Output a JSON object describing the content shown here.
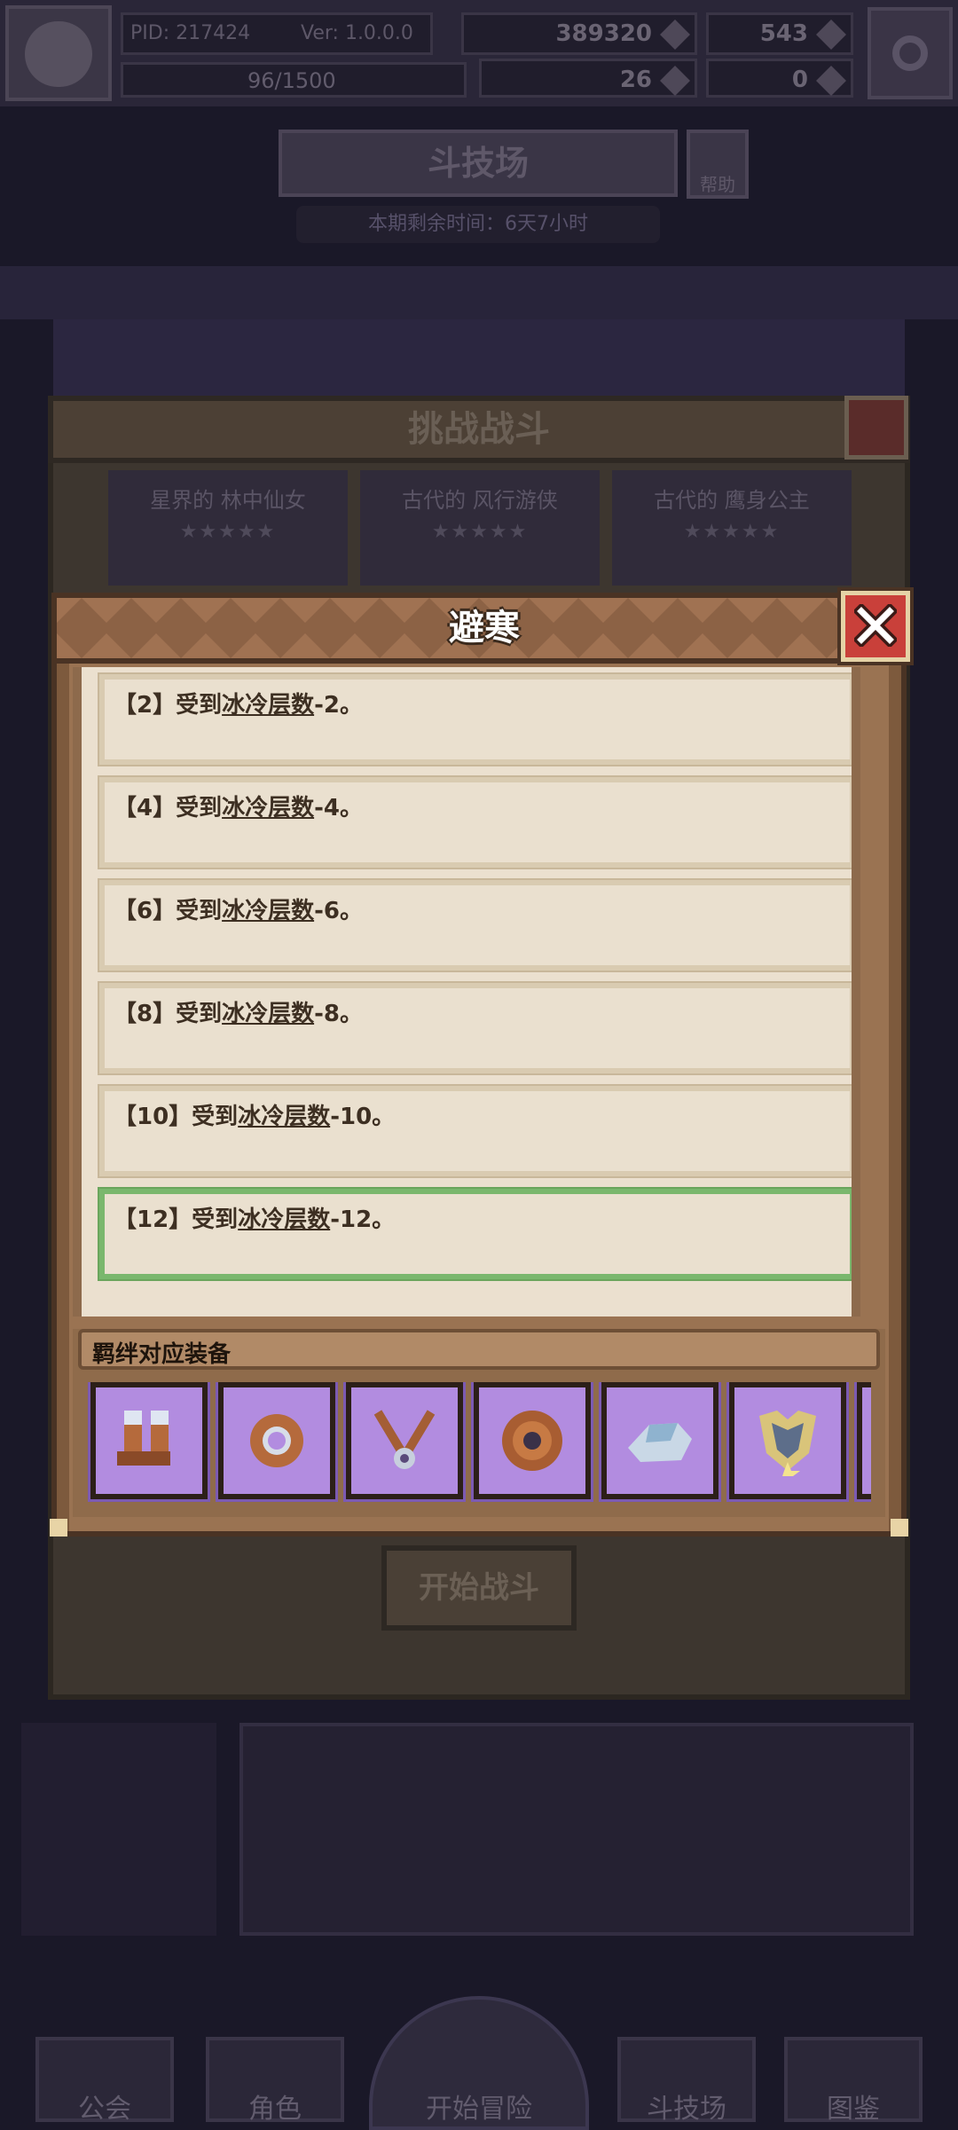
{
  "header": {
    "pid": "PID: 217424",
    "version": "Ver: 1.0.0.0",
    "gold": "389320",
    "gems": "543",
    "stamina": "96/1500",
    "keys": "26",
    "tickets": "0"
  },
  "arena": {
    "title": "斗技场",
    "help": "帮助",
    "remaining": "本期剩余时间：6天7小时"
  },
  "challenge": {
    "title": "挑战战斗",
    "heroes": [
      {
        "name": "星界的 林中仙女",
        "stars": "★★★★★"
      },
      {
        "name": "古代的 风行游侠",
        "stars": "★★★★★"
      },
      {
        "name": "古代的 鹰身公主",
        "stars": "★★★★★"
      }
    ],
    "start_button": "开始战斗"
  },
  "modal": {
    "title": "避寒",
    "entries": [
      {
        "prefix": "【2】受到",
        "keyword": "冰冷层数",
        "suffix": "-2。"
      },
      {
        "prefix": "【4】受到",
        "keyword": "冰冷层数",
        "suffix": "-4。"
      },
      {
        "prefix": "【6】受到",
        "keyword": "冰冷层数",
        "suffix": "-6。"
      },
      {
        "prefix": "【8】受到",
        "keyword": "冰冷层数",
        "suffix": "-8。"
      },
      {
        "prefix": "【10】受到",
        "keyword": "冰冷层数",
        "suffix": "-10。"
      },
      {
        "prefix": "【12】受到",
        "keyword": "冰冷层数",
        "suffix": "-12。"
      }
    ],
    "bond_label": "羁绊对应装备",
    "equipment_icons": [
      "boots-icon",
      "ring-icon",
      "amulet-icon",
      "shield-icon",
      "shoulder-armor-icon",
      "chest-armor-icon",
      "partial-item-icon"
    ]
  },
  "nav": {
    "guild": "公会",
    "character": "角色",
    "adventure": "开始冒险",
    "arena": "斗技场",
    "codex": "图鉴"
  },
  "colors": {
    "active_border": "#7ab76d",
    "close_red": "#c9403a",
    "panel_brown": "#7d5a3d",
    "item_purple": "#b28ce0"
  }
}
